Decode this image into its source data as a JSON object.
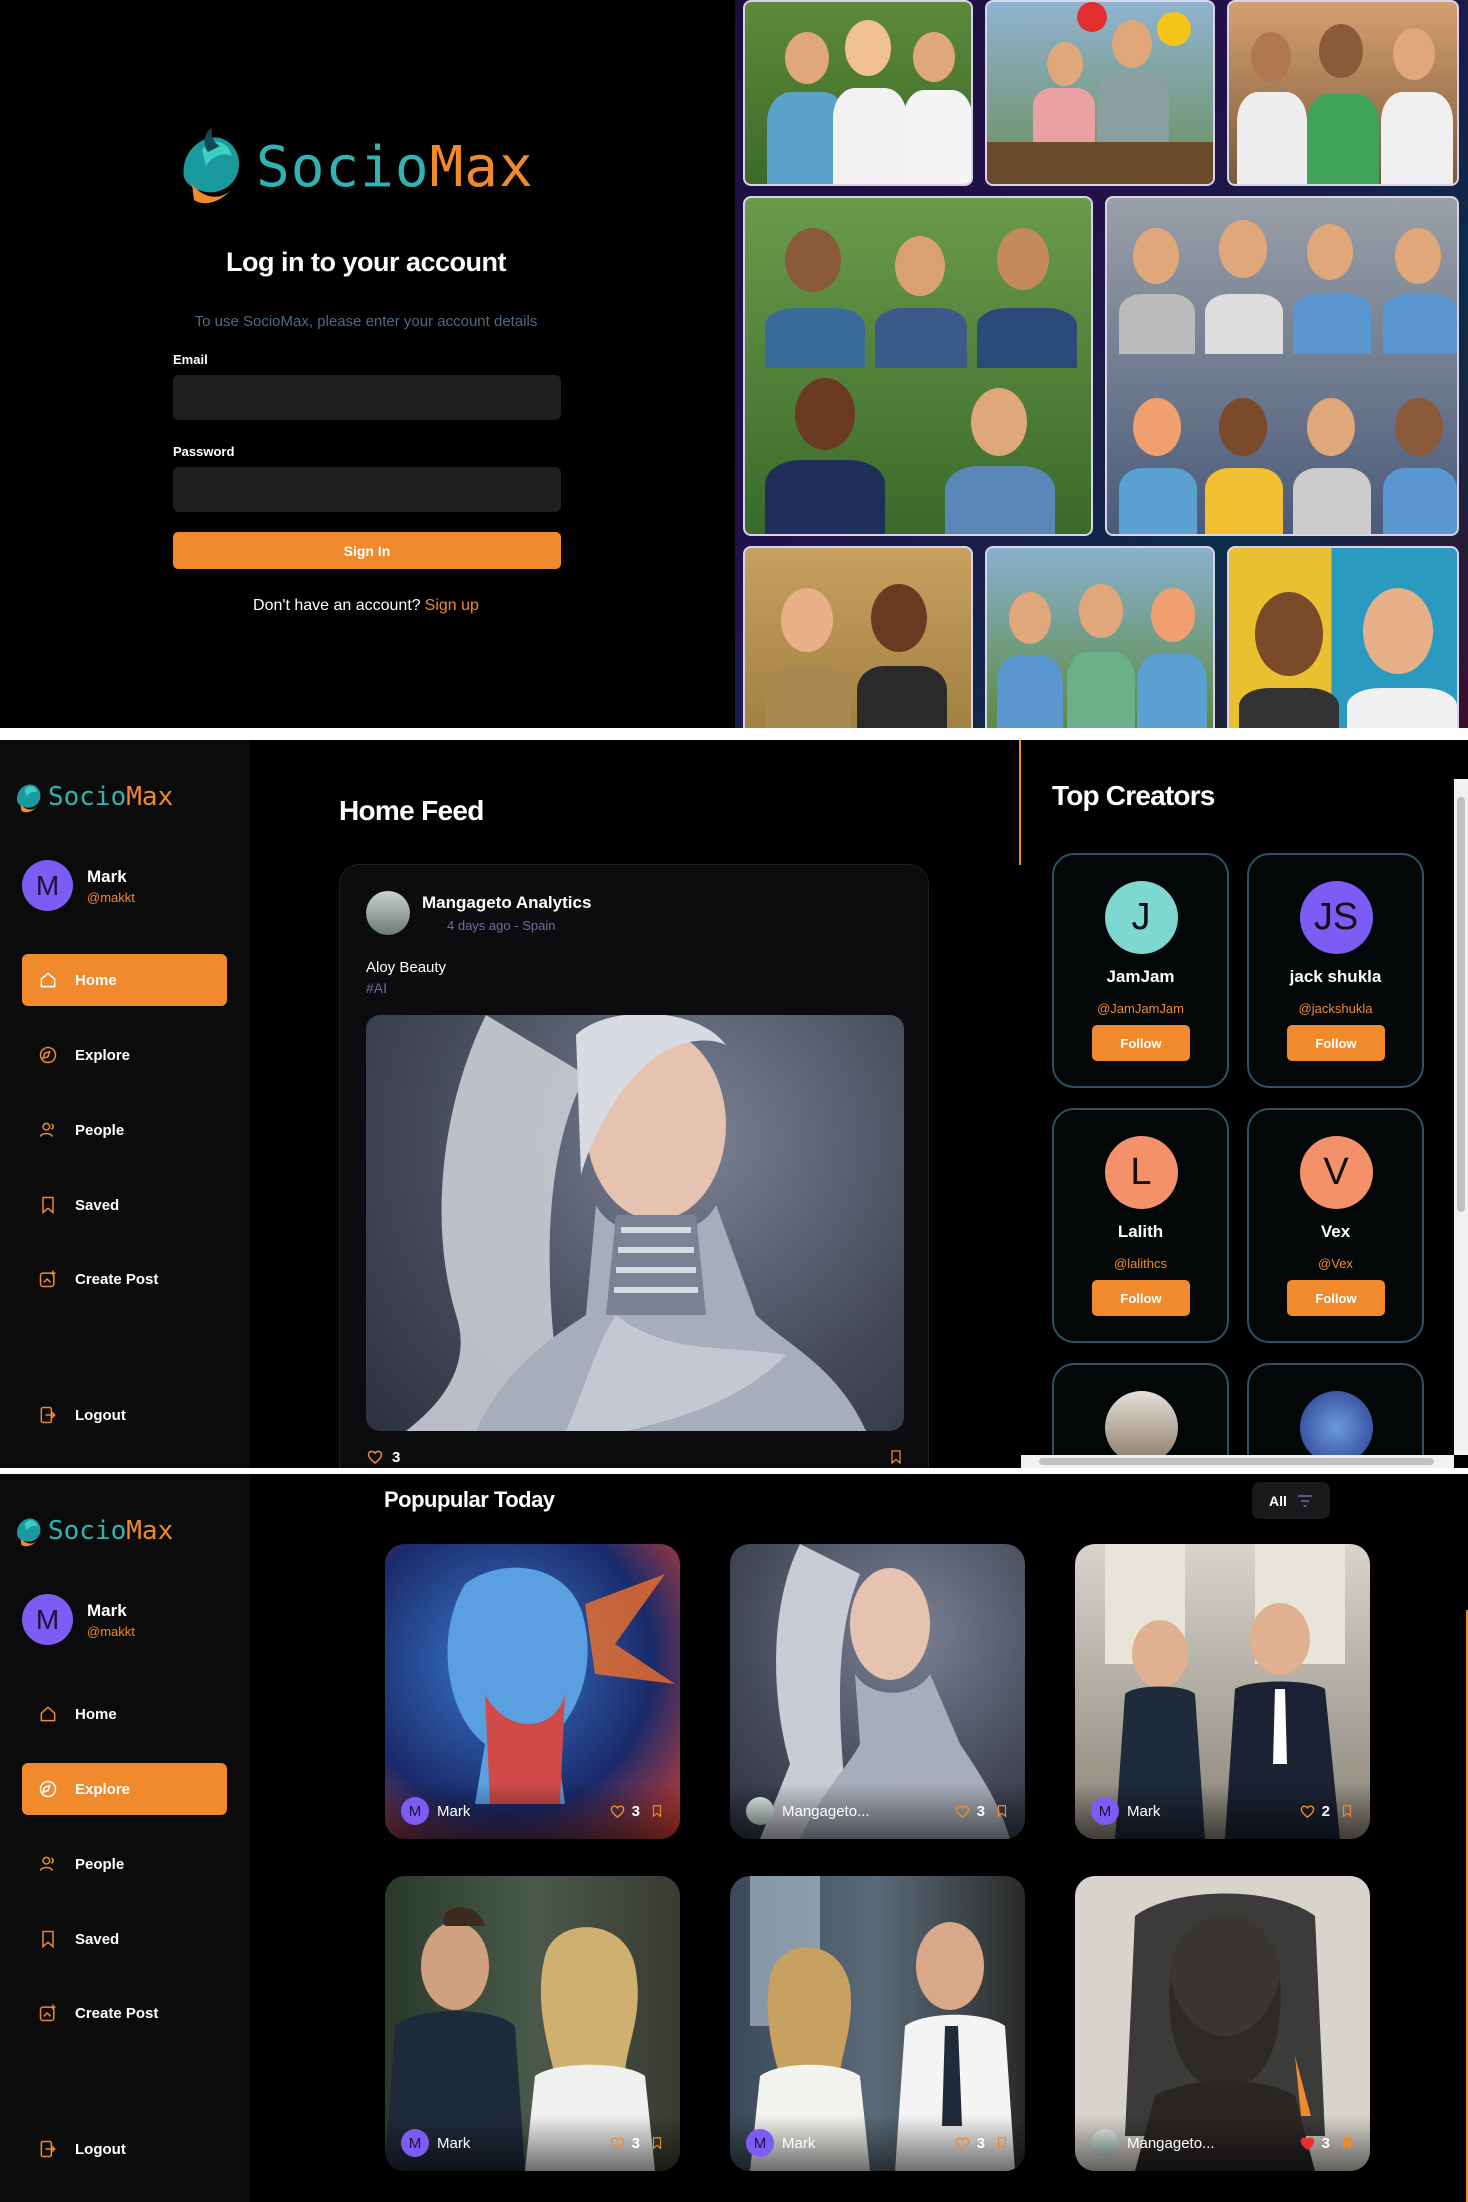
{
  "brand": {
    "name_part1": "Socio",
    "name_part2": "Max",
    "accent": "#f08a2c",
    "teal": "#2fb3b3"
  },
  "login": {
    "title": "Log in to your account",
    "subtitle": "To use SocioMax, please enter your account details",
    "email_label": "Email",
    "email_value": "",
    "password_label": "Password",
    "password_value": "",
    "signin_label": "Sign In",
    "signup_prompt": "Don't have an account?",
    "signup_link": "Sign up"
  },
  "user": {
    "initial": "M",
    "name": "Mark",
    "handle": "@makkt"
  },
  "nav": {
    "home": "Home",
    "explore": "Explore",
    "people": "People",
    "saved": "Saved",
    "create": "Create Post",
    "logout": "Logout"
  },
  "home": {
    "title": "Home Feed",
    "post": {
      "author": "Mangageto Analytics",
      "time": "4 days ago",
      "sep": "-",
      "location": "Spain",
      "caption": "Aloy Beauty",
      "tag": "#AI",
      "likes": "3"
    }
  },
  "creators": {
    "title": "Top Creators",
    "follow_label": "Follow",
    "items": [
      {
        "initial": "J",
        "name": "JamJam",
        "handle": "@JamJamJam",
        "color": "#7fd8cf"
      },
      {
        "initial": "JS",
        "name": "jack shukla",
        "handle": "@jackshukla",
        "color": "#7c5cf5"
      },
      {
        "initial": "L",
        "name": "Lalith",
        "handle": "@lalithcs",
        "color": "#f5916a"
      },
      {
        "initial": "V",
        "name": "Vex",
        "handle": "@Vex",
        "color": "#f5916a"
      }
    ]
  },
  "explore": {
    "title": "Popupular Today",
    "filter": "All",
    "cards": [
      {
        "initial": "M",
        "author": "Mark",
        "likes": "3"
      },
      {
        "initial": "",
        "author": "Mangageto...",
        "likes": "3"
      },
      {
        "initial": "M",
        "author": "Mark",
        "likes": "2"
      },
      {
        "initial": "M",
        "author": "Mark",
        "likes": "3"
      },
      {
        "initial": "M",
        "author": "Mark",
        "likes": "3"
      },
      {
        "initial": "",
        "author": "Mangageto...",
        "likes": "3"
      }
    ]
  }
}
